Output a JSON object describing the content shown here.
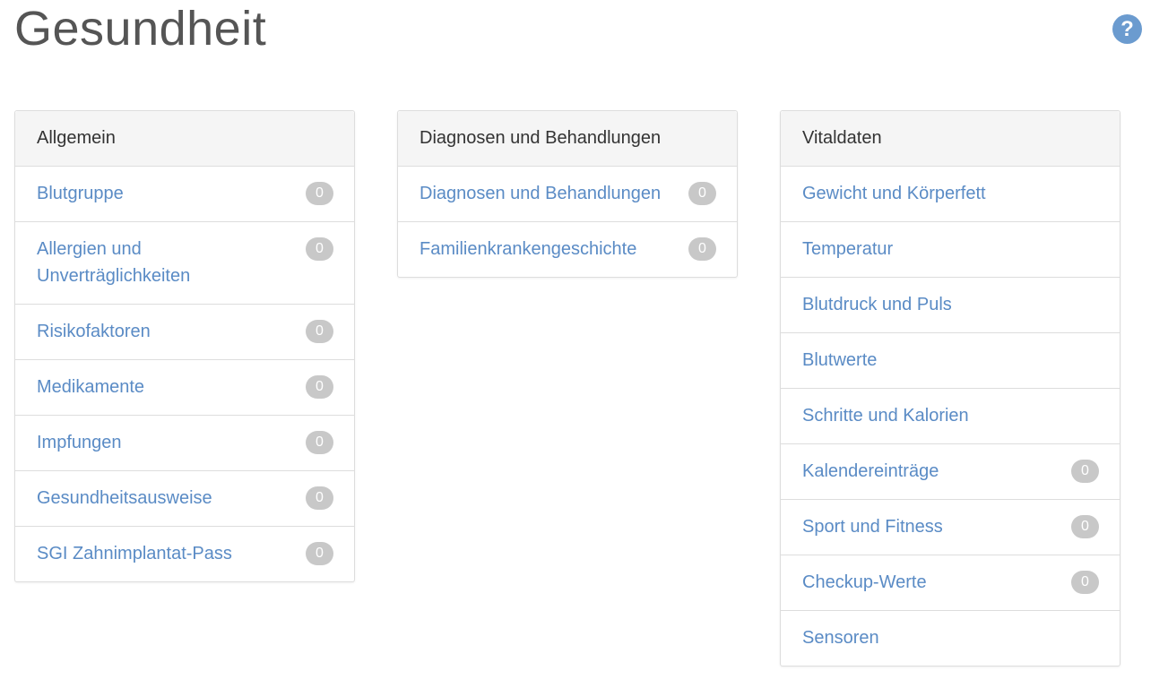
{
  "title": "Gesundheit",
  "help_icon": "question-circle-icon",
  "help_glyph": "?",
  "accent_color": "#5a8bc5",
  "panels": [
    {
      "header": "Allgemein",
      "items": [
        {
          "label": "Blutgruppe",
          "count": "0"
        },
        {
          "label": "Allergien und Unverträglichkeiten",
          "count": "0"
        },
        {
          "label": "Risikofaktoren",
          "count": "0"
        },
        {
          "label": "Medikamente",
          "count": "0"
        },
        {
          "label": "Impfungen",
          "count": "0"
        },
        {
          "label": "Gesundheitsausweise",
          "count": "0"
        },
        {
          "label": "SGI Zahnimplantat-Pass",
          "count": "0"
        }
      ]
    },
    {
      "header": "Diagnosen und Behandlungen",
      "items": [
        {
          "label": "Diagnosen und Behandlungen",
          "count": "0"
        },
        {
          "label": "Familienkrankengeschichte",
          "count": "0"
        }
      ]
    },
    {
      "header": "Vitaldaten",
      "items": [
        {
          "label": "Gewicht und Körperfett",
          "count": null
        },
        {
          "label": "Temperatur",
          "count": null
        },
        {
          "label": "Blutdruck und Puls",
          "count": null
        },
        {
          "label": "Blutwerte",
          "count": null
        },
        {
          "label": "Schritte und Kalorien",
          "count": null
        },
        {
          "label": "Kalendereinträge",
          "count": "0"
        },
        {
          "label": "Sport und Fitness",
          "count": "0"
        },
        {
          "label": "Checkup-Werte",
          "count": "0"
        },
        {
          "label": "Sensoren",
          "count": null
        }
      ]
    }
  ]
}
